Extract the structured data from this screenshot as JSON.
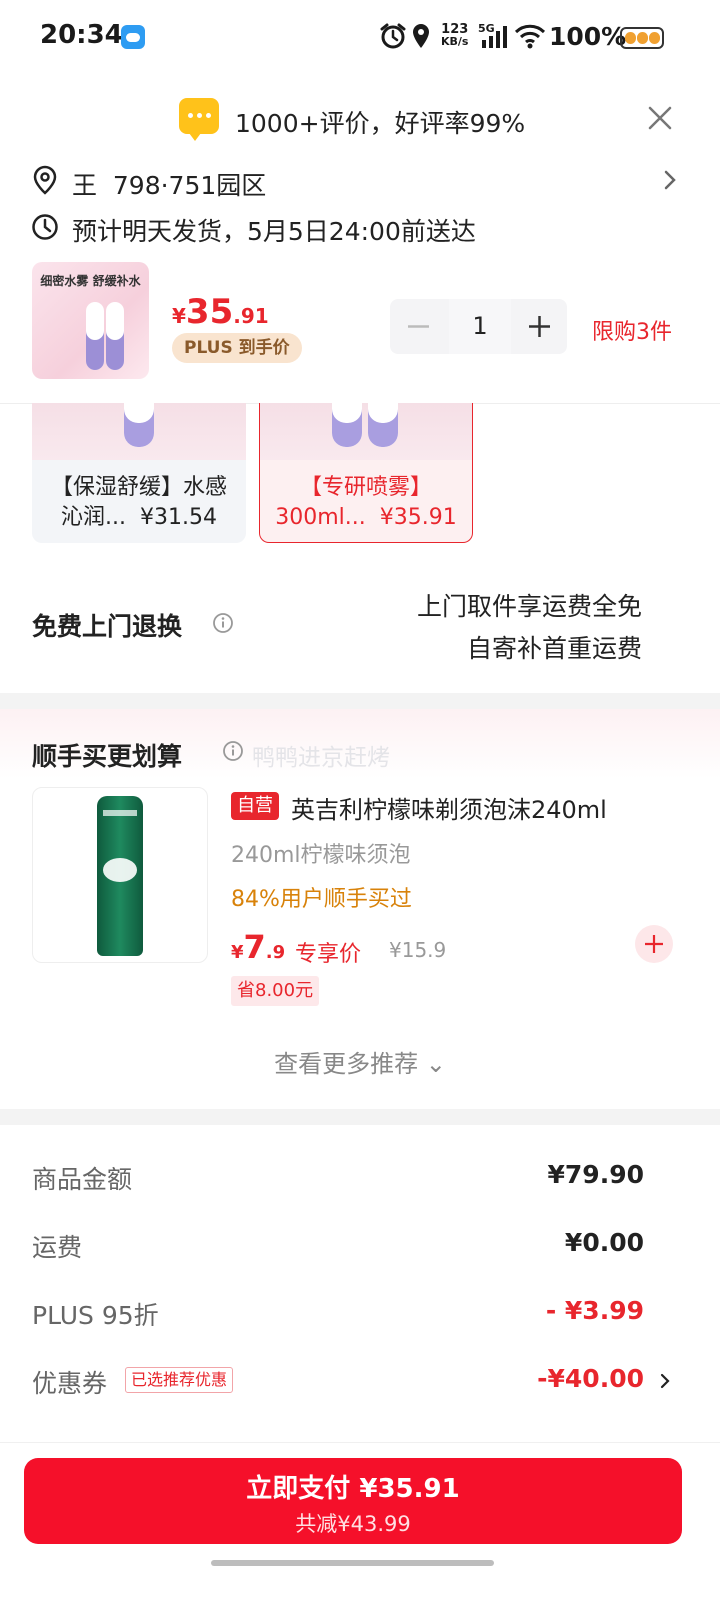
{
  "status_bar": {
    "time": "20:34",
    "net_speed_value": "123",
    "net_speed_unit": "KB/s",
    "network": "5G",
    "battery": "100%"
  },
  "rating": {
    "text": "1000+评价，好评率99%"
  },
  "address": {
    "text": "王  798·751园区",
    "delivery": "预计明天发货，5月5日24:00前送达"
  },
  "product": {
    "thumb_caption": "细密水雾 舒缓补水",
    "price_symbol": "¥",
    "price_int": "35",
    "price_dec": ".91",
    "plus_badge": "PLUS 到手价",
    "quantity": "1",
    "limit": "限购3件"
  },
  "variants": [
    {
      "line1": "【保湿舒缓】水感",
      "line2": "沁润...  ¥31.54",
      "selected": false
    },
    {
      "line1": "【专研喷雾】",
      "line2": "300ml...  ¥35.91",
      "selected": true
    }
  ],
  "free_return": {
    "label": "免费上门退换",
    "line1": "上门取件享运费全免",
    "line2": "自寄补首重运费"
  },
  "recommendation": {
    "title": "顺手买更划算",
    "watermark": "鸭鸭进京赶烤",
    "item": {
      "badge": "自营",
      "name": "英吉利柠檬味剃须泡沫240ml",
      "spec": "240ml柠檬味须泡",
      "social": "84%用户顺手买过",
      "price_symbol": "¥",
      "price_int": "7",
      "price_dec": ".9",
      "price_label": "专享价",
      "original_price": "¥15.9",
      "save": "省8.00元"
    },
    "more": "查看更多推荐 ⌄"
  },
  "summary": [
    {
      "label": "商品金额",
      "value": "¥79.90",
      "red": false
    },
    {
      "label": "运费",
      "value": "¥0.00",
      "red": false
    },
    {
      "label": "PLUS 95折",
      "value": "- ¥3.99",
      "red": true
    },
    {
      "label": "优惠券",
      "value": "-¥40.00",
      "red": true,
      "tag": "已选推荐优惠"
    }
  ],
  "pay": {
    "label": "立即支付 ¥35.91",
    "sub": "共减¥43.99"
  },
  "colors": {
    "accent_red": "#e8262d",
    "pay_button": "#f5102a",
    "rating_badge": "#ffc21a",
    "social_orange": "#d8820a"
  }
}
